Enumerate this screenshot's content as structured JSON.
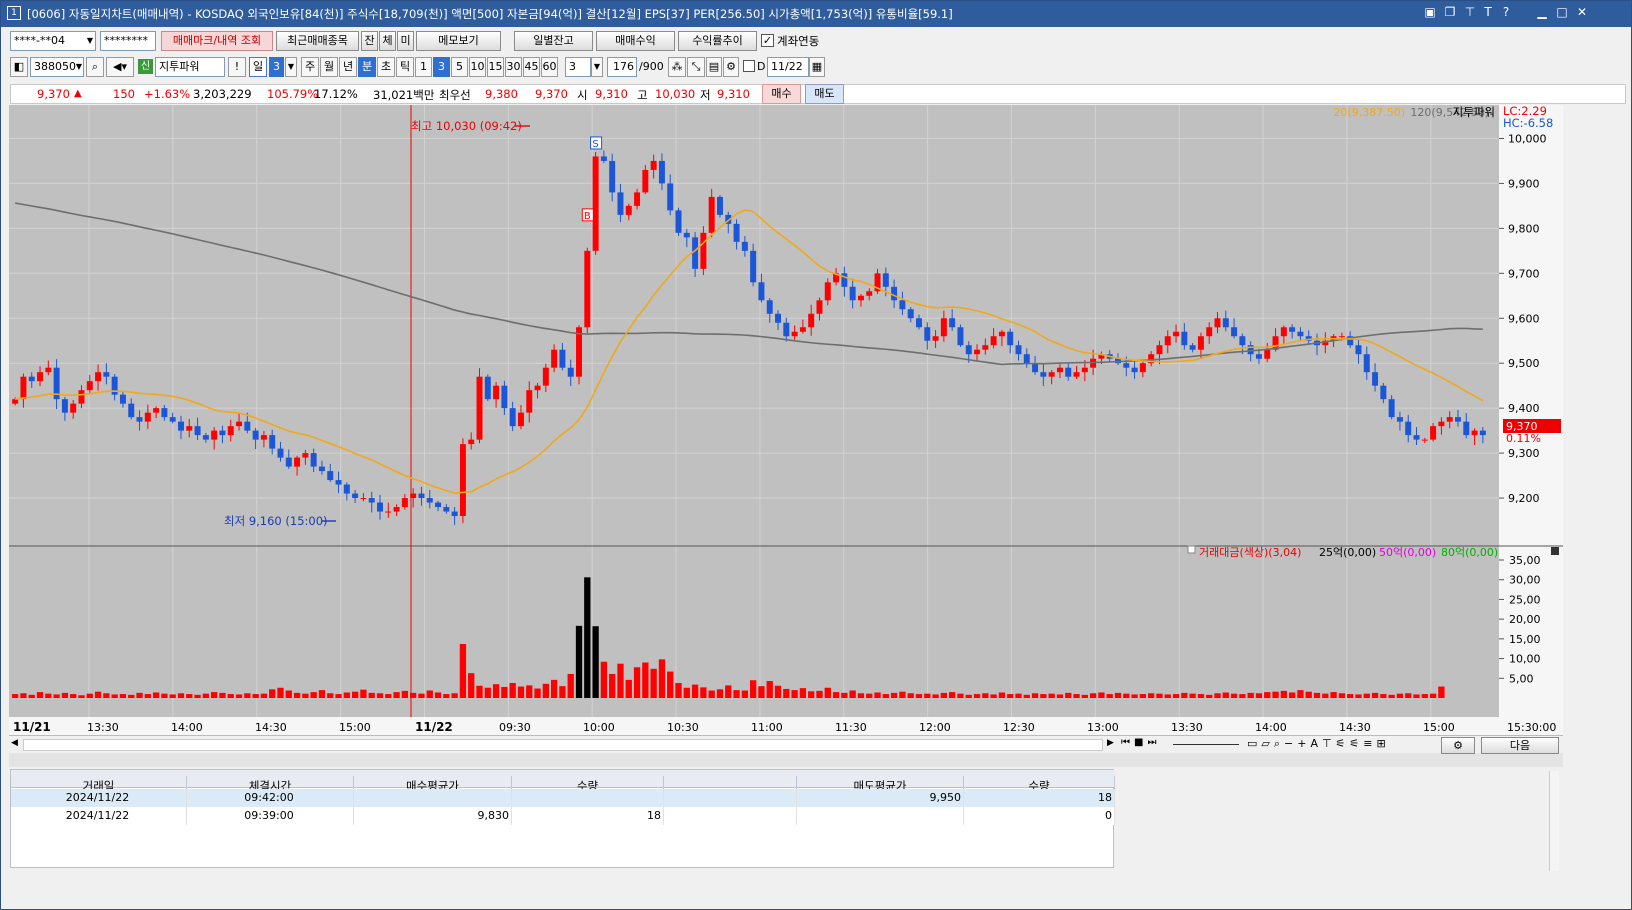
{
  "titlebar": {
    "title": "[0606] 자동일지차트(매매내역) - KOSDAQ 외국인보유[84(천)] 주식수[18,709(천)] 액면[500] 자본금[94(억)] 결산[12월] EPS[37] PER[256.50] 시가총액[1,753(억)] 유통비율[59.1]",
    "window_number": "1",
    "icons": [
      "layout-icon",
      "duplicate-icon",
      "pin-icon",
      "font-icon",
      "help-icon",
      "minimize-icon",
      "maximize-icon",
      "close-icon"
    ]
  },
  "toolbar1": {
    "account": "****-**04",
    "password": "********",
    "btn_trade_mark": "매매마크/내역 조회",
    "btn_recent": "최근매매종목",
    "btn_jan": "잔",
    "btn_che": "체",
    "btn_mi": "미",
    "btn_memo": "메모보기",
    "btn_daily": "일별잔고",
    "btn_profit": "매매수익",
    "btn_return": "수익률추이",
    "chk_account_link": "계좌연동"
  },
  "toolbar2": {
    "code": "388050",
    "indicator_badge": "신",
    "stock_name": "지투파워",
    "excl": "!",
    "day": "일",
    "day_num": "3",
    "periods": [
      "주",
      "월",
      "년",
      "분",
      "초",
      "틱"
    ],
    "period_selected": "분",
    "minutes": [
      "1",
      "3",
      "5",
      "10",
      "15",
      "30",
      "45",
      "60"
    ],
    "minute_selected": "3",
    "interval": "3",
    "count": "176",
    "count_total": "/900",
    "d_label": "D",
    "date": "11/22"
  },
  "quote": {
    "price": "9,370",
    "up_arrow": "▲",
    "change": "150",
    "change_pct": "+1.63%",
    "volume": "3,203,229",
    "vol_ratio": "105.79%",
    "turnover": "17.12%",
    "amount": "31,021백만",
    "best_label": "최우선",
    "best_ask": "9,380",
    "best_bid": "9,370",
    "open_label": "시",
    "open": "9,310",
    "high_label": "고",
    "high": "10,030",
    "low_label": "저",
    "low": "9,310",
    "buy_btn": "매수",
    "sell_btn": "매도"
  },
  "chart_data": {
    "type": "candlestick",
    "ma_labels": {
      "ma20": "20(9,387.50)",
      "ma120": "120(9,542.58)"
    },
    "symbol": "지투파워",
    "lc": "LC:2.29",
    "hc": "HC:-6.58",
    "y_ticks": [
      "10,000",
      "9,900",
      "9,800",
      "9,700",
      "9,600",
      "9,500",
      "9,400",
      "9,300",
      "9,200"
    ],
    "ylim": [
      9100,
      10070
    ],
    "current_price": "9,370",
    "current_pct": "0.11%",
    "high_annotation": "최고 10,030 (09:42)",
    "low_annotation": "최저 9,160 (15:00)",
    "buy_marker": "B",
    "sell_marker": "S",
    "x_labels": [
      "11/21",
      "13:30",
      "14:00",
      "14:30",
      "15:00",
      "11/22",
      "09:30",
      "10:00",
      "10:30",
      "11:00",
      "11:30",
      "12:00",
      "12:30",
      "13:00",
      "13:30",
      "14:00",
      "14:30",
      "15:00",
      "15:30:00"
    ],
    "closes": [
      9420,
      9470,
      9460,
      9480,
      9490,
      9420,
      9390,
      9410,
      9440,
      9460,
      9480,
      9470,
      9430,
      9410,
      9380,
      9370,
      9390,
      9400,
      9380,
      9370,
      9350,
      9360,
      9340,
      9330,
      9350,
      9340,
      9360,
      9370,
      9350,
      9330,
      9340,
      9310,
      9290,
      9270,
      9290,
      9300,
      9270,
      9260,
      9240,
      9230,
      9210,
      9200,
      9200,
      9190,
      9170,
      9170,
      9180,
      9200,
      9210,
      9200,
      9190,
      9180,
      9170,
      9160,
      9320,
      9330,
      9470,
      9420,
      9450,
      9400,
      9360,
      9390,
      9440,
      9450,
      9490,
      9530,
      9490,
      9470,
      9580,
      9750,
      9960,
      9950,
      9880,
      9830,
      9850,
      9880,
      9930,
      9950,
      9900,
      9840,
      9790,
      9780,
      9710,
      9790,
      9870,
      9830,
      9810,
      9770,
      9750,
      9680,
      9640,
      9610,
      9590,
      9560,
      9570,
      9580,
      9610,
      9640,
      9680,
      9700,
      9670,
      9640,
      9650,
      9660,
      9700,
      9670,
      9640,
      9620,
      9600,
      9580,
      9550,
      9560,
      9600,
      9580,
      9540,
      9520,
      9530,
      9540,
      9560,
      9570,
      9540,
      9520,
      9500,
      9480,
      9470,
      9480,
      9490,
      9470,
      9480,
      9490,
      9510,
      9520,
      9510,
      9500,
      9490,
      9480,
      9500,
      9520,
      9540,
      9560,
      9570,
      9540,
      9530,
      9560,
      9580,
      9600,
      9580,
      9560,
      9540,
      9520,
      9510,
      9530,
      9560,
      9580,
      9570,
      9560,
      9550,
      9540,
      9550,
      9560,
      9560,
      9540,
      9520,
      9480,
      9450,
      9420,
      9380,
      9370,
      9340,
      9330,
      9330,
      9360,
      9370,
      9380,
      9370,
      9340,
      9350,
      9340
    ],
    "volume_axis": [
      "35,00",
      "30,00",
      "25,00",
      "20,00",
      "15,00",
      "10,00",
      "5,00"
    ],
    "volume_legend": "거래대금(색상)(3,04)",
    "legend_25": "25억(0,00)",
    "legend_50": "50억(0,00)",
    "legend_80": "80억(0,00)",
    "volumes": [
      1.0,
      1.2,
      0.8,
      1.5,
      1.1,
      0.9,
      1.3,
      1.0,
      0.7,
      1.1,
      1.6,
      1.2,
      0.9,
      1.0,
      0.8,
      1.3,
      1.0,
      1.4,
      1.1,
      0.9,
      1.2,
      1.0,
      0.8,
      1.1,
      1.5,
      1.3,
      1.0,
      0.9,
      1.2,
      1.0,
      1.1,
      2.2,
      2.6,
      1.9,
      1.3,
      1.1,
      1.5,
      2.0,
      1.2,
      1.0,
      1.4,
      1.6,
      2.1,
      1.3,
      1.2,
      1.0,
      1.5,
      1.8,
      1.3,
      1.1,
      1.9,
      1.4,
      1.0,
      1.2,
      13.7,
      6.3,
      3.1,
      2.6,
      3.5,
      2.8,
      3.8,
      2.9,
      3.2,
      2.4,
      3.6,
      4.6,
      3.0,
      6.1,
      18.3,
      30.6,
      18.2,
      9.2,
      6.1,
      8.7,
      4.6,
      7.8,
      9.0,
      7.4,
      9.8,
      6.7,
      3.8,
      2.6,
      3.4,
      2.7,
      1.9,
      2.2,
      3.2,
      2.0,
      1.9,
      4.5,
      3.0,
      4.3,
      3.1,
      2.3,
      2.0,
      2.5,
      1.7,
      1.8,
      2.6,
      1.5,
      1.3,
      1.9,
      1.2,
      1.1,
      1.4,
      1.0,
      1.3,
      1.6,
      1.2,
      1.0,
      1.1,
      0.9,
      1.3,
      1.5,
      1.1,
      0.8,
      1.0,
      1.2,
      0.9,
      1.4,
      1.0,
      1.1,
      0.8,
      1.2,
      1.0,
      1.1,
      0.9,
      1.3,
      1.0,
      0.8,
      1.2,
      1.4,
      1.0,
      1.3,
      1.1,
      0.9,
      1.0,
      1.2,
      1.1,
      0.9,
      1.0,
      1.3,
      1.1,
      1.0,
      0.8,
      1.2,
      1.4,
      1.1,
      1.0,
      1.3,
      1.2,
      1.5,
      1.6,
      1.8,
      1.4,
      2.0,
      1.6,
      1.3,
      1.1,
      1.5,
      1.2,
      1.0,
      0.9,
      1.1,
      1.3,
      1.0,
      0.8,
      1.1,
      1.2,
      0.9,
      1.0,
      1.1,
      2.9
    ]
  },
  "nav": {
    "gear": "⚙",
    "next_btn": "다음"
  },
  "trades": {
    "headers": [
      "거래일",
      "체결시간",
      "매수평균가",
      "수량",
      "",
      "매도평균가",
      "수량"
    ],
    "rows": [
      {
        "date": "2024/11/22",
        "time": "09:42:00",
        "buy_avg": "",
        "buy_qty": "",
        "blank": "",
        "sell_avg": "9,950",
        "sell_qty": "18"
      },
      {
        "date": "2024/11/22",
        "time": "09:39:00",
        "buy_avg": "9,830",
        "buy_qty": "18",
        "blank": "",
        "sell_avg": "",
        "sell_qty": "0"
      }
    ]
  },
  "colors": {
    "up": "#ff0000",
    "down": "#1a56d6",
    "ma20": "#f0a81c",
    "ma120": "#6e6e6e",
    "title": "#2f5c9c"
  }
}
